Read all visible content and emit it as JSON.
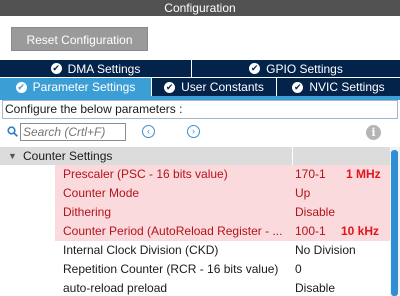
{
  "window": {
    "title": "Configuration"
  },
  "toolbar": {
    "reset_label": "Reset Configuration"
  },
  "tabs_top": [
    {
      "label": "DMA Settings"
    },
    {
      "label": "GPIO Settings"
    }
  ],
  "tabs_bottom": [
    {
      "label": "Parameter Settings",
      "active": true
    },
    {
      "label": "User Constants"
    },
    {
      "label": "NVIC Settings"
    }
  ],
  "config_label": "Configure the below parameters :",
  "search": {
    "placeholder": "Search (Crtl+F)"
  },
  "icons": {
    "check": "✔",
    "prev": "‹",
    "next": "›",
    "info": "i",
    "caret": "▼"
  },
  "group": {
    "label": "Counter Settings"
  },
  "params": [
    {
      "name": "Prescaler (PSC - 16 bits value)",
      "value": "170-1",
      "note": "1 MHz"
    },
    {
      "name": "Counter Mode",
      "value": "Up",
      "note": ""
    },
    {
      "name": "Dithering",
      "value": "Disable",
      "note": ""
    },
    {
      "name": "Counter Period (AutoReload Register - ...",
      "value": "100-1",
      "note": "10 kHz"
    },
    {
      "name": "Internal Clock Division (CKD)",
      "value": "No Division",
      "note": ""
    },
    {
      "name": "Repetition Counter (RCR - 16 bits value)",
      "value": "0",
      "note": ""
    },
    {
      "name": "auto-reload preload",
      "value": "Disable",
      "note": ""
    }
  ],
  "colors": {
    "tab_dark": "#03234b",
    "tab_active": "#3b9fd6",
    "highlight": "#fadadc",
    "note_red": "#e4141b"
  }
}
